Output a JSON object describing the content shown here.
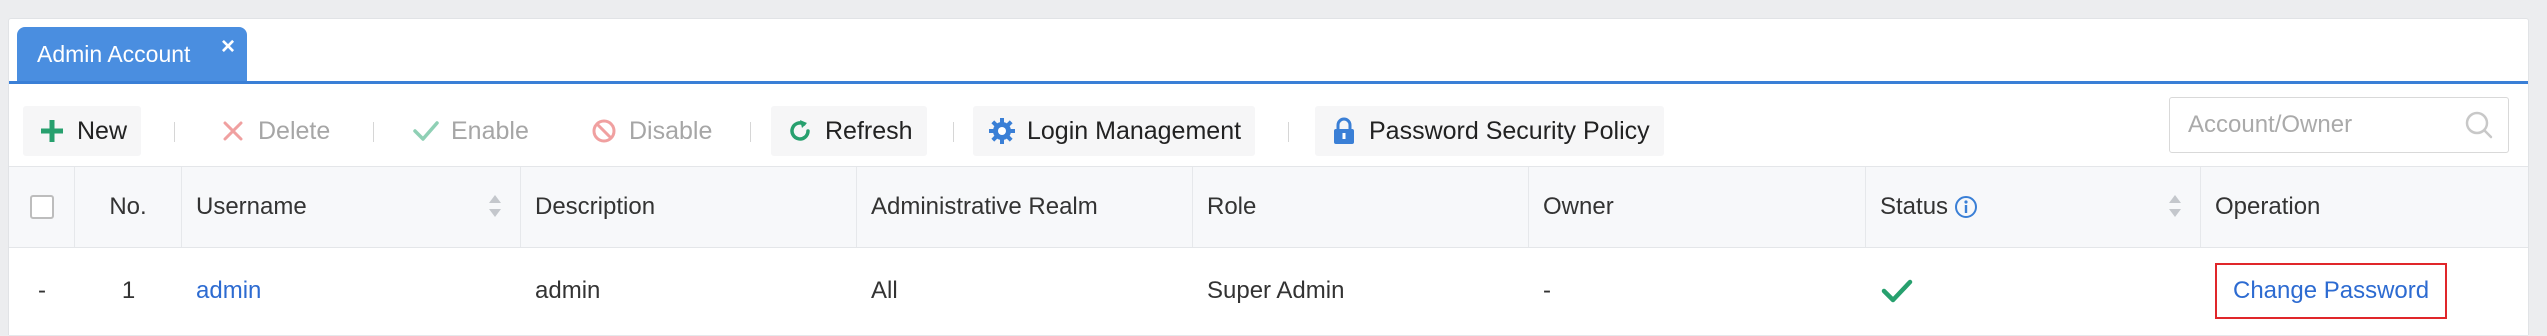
{
  "tab": {
    "label": "Admin Account",
    "close": "×"
  },
  "toolbar": {
    "new": "New",
    "delete": "Delete",
    "enable": "Enable",
    "disable": "Disable",
    "refresh": "Refresh",
    "login_management": "Login Management",
    "password_policy": "Password Security Policy"
  },
  "search": {
    "placeholder": "Account/Owner"
  },
  "table": {
    "columns": [
      "No.",
      "Username",
      "Description",
      "Administrative Realm",
      "Role",
      "Owner",
      "Status",
      "Operation"
    ],
    "rows": [
      {
        "expand": "-",
        "no": "1",
        "username": "admin",
        "description": "admin",
        "realm": "All",
        "role": "Super Admin",
        "owner": "-",
        "status": "enabled",
        "operation": "Change Password"
      }
    ]
  },
  "colors": {
    "accent": "#3a7fd6",
    "link": "#2d6bd1",
    "success": "#27a06e",
    "highlight": "#e0262a"
  }
}
